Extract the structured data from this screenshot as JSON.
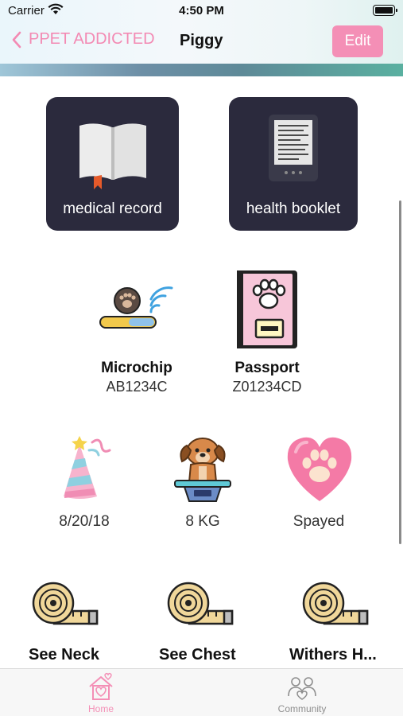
{
  "status_bar": {
    "carrier": "Carrier",
    "time": "4:50 PM"
  },
  "nav": {
    "back_label": "PPET ADDICTED",
    "title": "Piggy",
    "edit_label": "Edit"
  },
  "cards": [
    {
      "label": "medical record",
      "icon": "book-icon"
    },
    {
      "label": "health booklet",
      "icon": "ebook-reader-icon"
    }
  ],
  "ids": [
    {
      "title": "Microchip",
      "value": "AB1234C",
      "icon": "microchip-icon"
    },
    {
      "title": "Passport",
      "value": "Z01234CD",
      "icon": "passport-icon"
    }
  ],
  "stats": [
    {
      "value": "8/20/18",
      "icon": "party-hat-icon"
    },
    {
      "value": "8 KG",
      "icon": "dog-on-scale-icon"
    },
    {
      "value": "Spayed",
      "icon": "paw-heart-icon"
    }
  ],
  "measurements": [
    {
      "label": "See Neck",
      "icon": "measuring-tape-icon"
    },
    {
      "label": "See Chest",
      "icon": "measuring-tape-icon"
    },
    {
      "label": "Withers H...",
      "icon": "measuring-tape-icon"
    }
  ],
  "tabs": [
    {
      "label": "Home",
      "icon": "home-heart-icon",
      "active": true
    },
    {
      "label": "Community",
      "icon": "community-icon",
      "active": false
    }
  ],
  "colors": {
    "accent": "#f48fb6",
    "card_bg": "#2b2a3d",
    "tab_inactive": "#8e8e8e"
  }
}
